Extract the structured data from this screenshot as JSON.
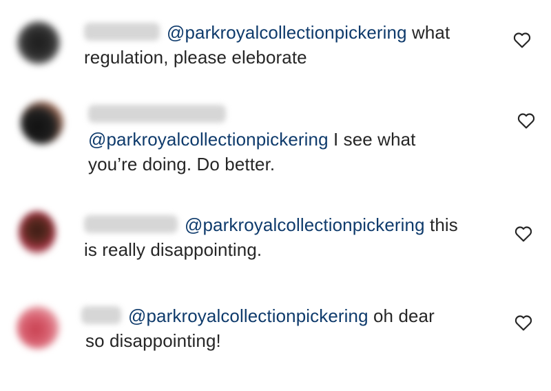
{
  "comments": [
    {
      "mention": "@parkroyalcollectionpickering",
      "text_line1": " what",
      "text_line2": "regulation, please eleborate",
      "like_icon": "heart-outline-icon"
    },
    {
      "mention": "@parkroyalcollectionpickering",
      "text_line1": " I see what",
      "text_line2": "you’re doing. Do better.",
      "like_icon": "heart-outline-icon"
    },
    {
      "mention": "@parkroyalcollectionpickering",
      "text_line1": " this",
      "text_line2": "is really disappointing.",
      "like_icon": "heart-outline-icon"
    },
    {
      "mention": "@parkroyalcollectionpickering",
      "text_line1": " oh dear",
      "text_line2": "so disappointing!",
      "like_icon": "heart-outline-icon"
    }
  ],
  "colors": {
    "mention": "#0f3b6c",
    "text": "#262626",
    "background": "#ffffff"
  }
}
